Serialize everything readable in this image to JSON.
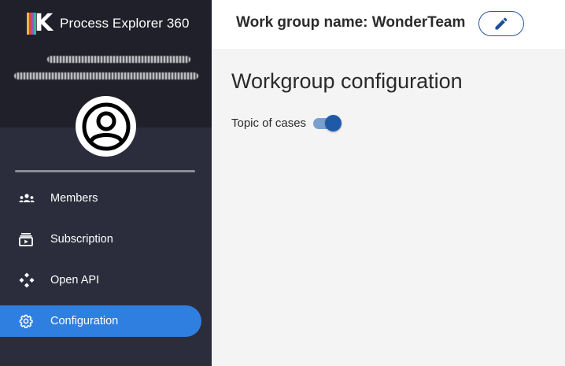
{
  "app": {
    "name": "Process Explorer 360"
  },
  "header": {
    "workgroup_label": "Work group name:",
    "workgroup_name": "WonderTeam"
  },
  "main": {
    "title": "Workgroup configuration",
    "toggle": {
      "label": "Topic of cases",
      "on": true
    }
  },
  "sidebar": {
    "items": [
      {
        "label": "Members",
        "icon": "members-icon",
        "active": false
      },
      {
        "label": "Subscription",
        "icon": "subscription-icon",
        "active": false
      },
      {
        "label": "Open API",
        "icon": "open-api-icon",
        "active": false
      },
      {
        "label": "Configuration",
        "icon": "gear-icon",
        "active": true
      }
    ]
  },
  "colors": {
    "sidebar_bg": "#2c2d3c",
    "sidebar_top_bg": "#1f2029",
    "accent": "#2e7fe0",
    "toggle": "#1f5aa8"
  }
}
